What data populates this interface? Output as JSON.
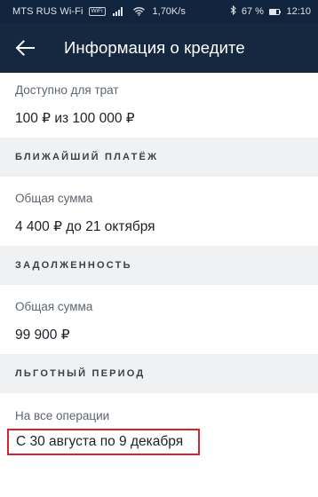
{
  "status_bar": {
    "carrier": "MTS RUS Wi-Fi",
    "wifi_chip": "WiFi",
    "speed": "1,70K/s",
    "battery": "67 %",
    "battery_level": 0.67,
    "time": "12:10"
  },
  "header": {
    "title": "Информация о кредите"
  },
  "available": {
    "label": "Доступно для трат",
    "value": "100 ₽ из 100 000 ₽"
  },
  "next_payment": {
    "section": "БЛИЖАЙШИЙ ПЛАТЁЖ",
    "label": "Общая сумма",
    "value": "4 400 ₽ до 21 октября"
  },
  "debt": {
    "section": "ЗАДОЛЖЕННОСТЬ",
    "label": "Общая сумма",
    "value": "99 900 ₽"
  },
  "grace_period": {
    "section": "ЛЬГОТНЫЙ ПЕРИОД",
    "label": "На все операции",
    "value": "С 30 августа по 9 декабря"
  },
  "colors": {
    "status_bar_bg": "#11243d",
    "app_bar_bg": "#14283f",
    "section_bg": "#f0f1f3",
    "highlight": "#d9222a"
  }
}
